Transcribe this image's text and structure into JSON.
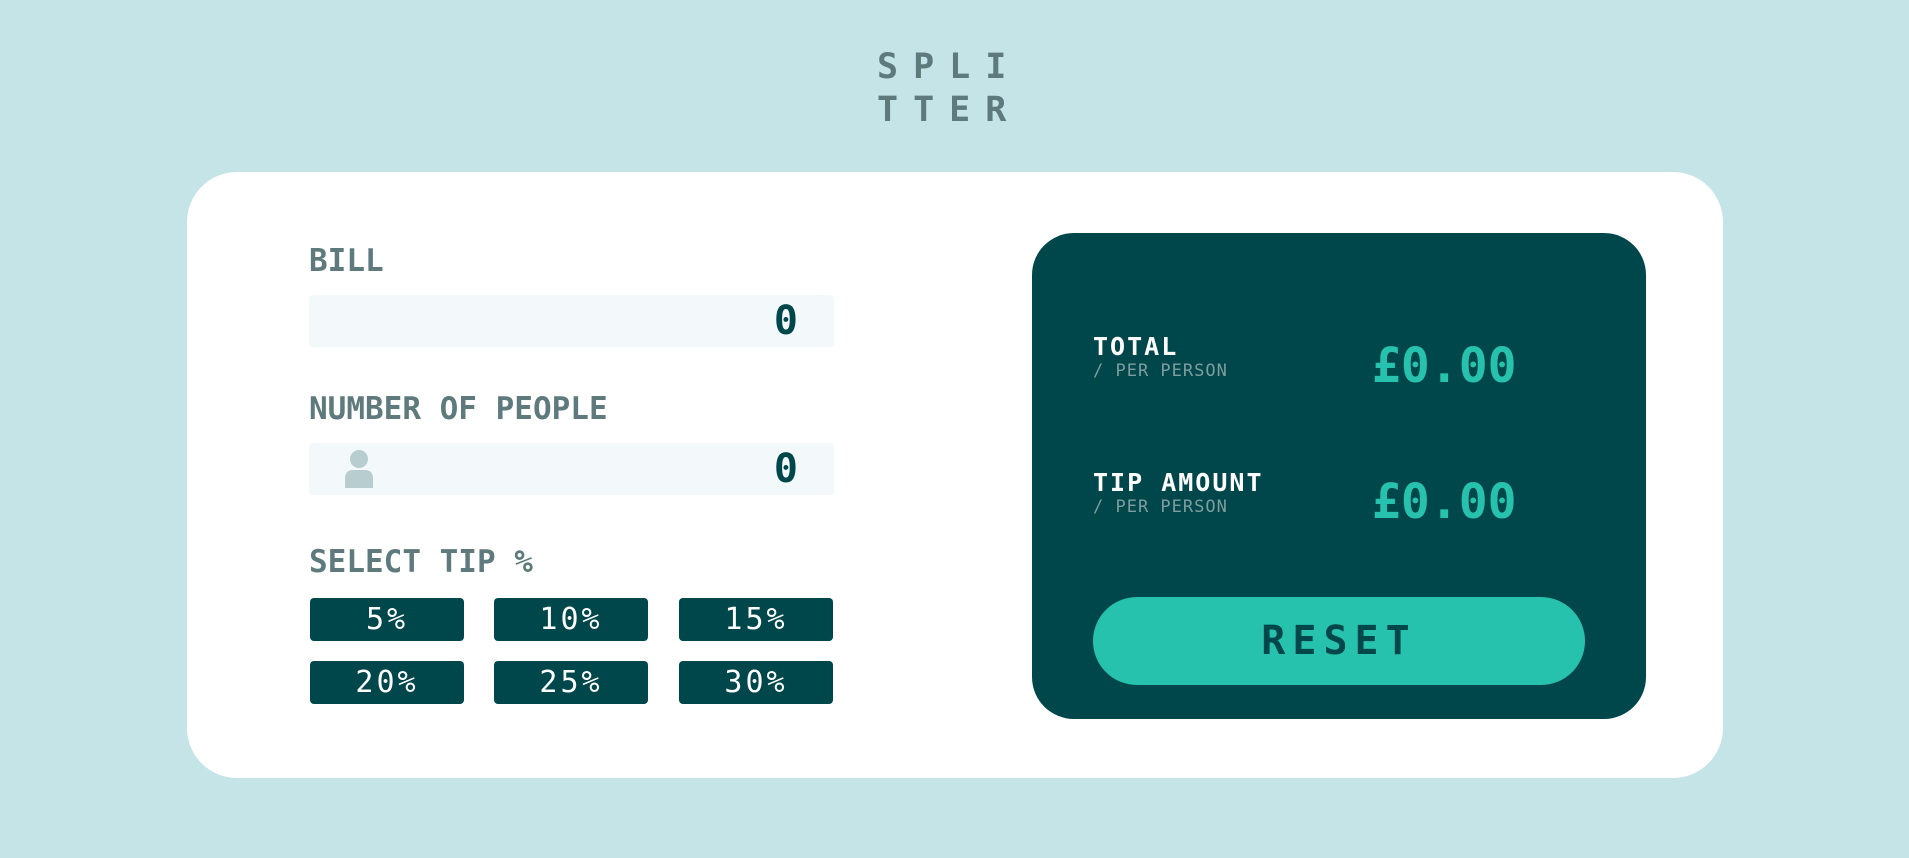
{
  "app": {
    "logo_line1": "SPLI",
    "logo_line2": "TTER"
  },
  "bill": {
    "label": "BILL",
    "value": "0"
  },
  "people": {
    "label": "NUMBER OF PEOPLE",
    "value": "0",
    "icon": "person-icon"
  },
  "tip": {
    "label": "SELECT TIP %",
    "options": [
      "5%",
      "10%",
      "15%",
      "20%",
      "25%",
      "30%"
    ]
  },
  "results": {
    "total_label": "TOTAL",
    "total_sub": "/ PER PERSON",
    "total_value": "£0.00",
    "tip_label": "TIP AMOUNT",
    "tip_sub": "/ PER PERSON",
    "tip_value": "£0.00",
    "reset_label": "RESET"
  },
  "colors": {
    "background": "#c5e4e7",
    "card": "#ffffff",
    "dark_cyan": "#00474b",
    "accent": "#26c2ad",
    "label_grey": "#5e7a7d",
    "input_bg": "#f3f9fa"
  }
}
